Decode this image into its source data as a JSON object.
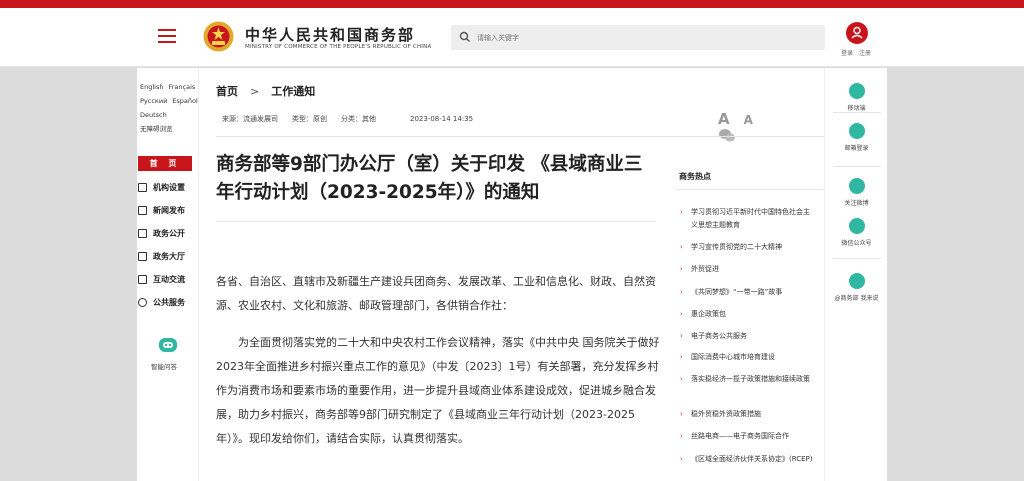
{
  "header": {
    "site_title": "中华人民共和国商务部",
    "site_subtitle": "MINISTRY OF COMMERCE OF THE PEOPLE'S REPUBLIC OF CHINA",
    "search_placeholder": "请输入关键字",
    "login": "登录",
    "register": "注册"
  },
  "left": {
    "langs": [
      "English",
      "Français",
      "Русский",
      "Español",
      "Deutsch",
      "无障碍浏览"
    ],
    "home": "首 页",
    "nav": [
      "机构设置",
      "新闻发布",
      "政务公开",
      "政务大厅",
      "互动交流",
      "公共服务"
    ],
    "assistant": "智能问答"
  },
  "article": {
    "breadcrumb_home": "首页",
    "breadcrumb_sep": ">",
    "breadcrumb_current": "工作通知",
    "source": "来源：流通发展司",
    "type": "类型：原创",
    "category": "分类：其他",
    "date": "2023-08-14 14:35",
    "title": "商务部等9部门办公厅（室）关于印发 《县域商业三年行动计划（2023-2025年）》的通知",
    "para1": "各省、自治区、直辖市及新疆生产建设兵团商务、发展改革、工业和信息化、财政、自然资源、农业农村、文化和旅游、邮政管理部门，各供销合作社：",
    "para2": "为全面贯彻落实党的二十大和中央农村工作会议精神，落实《中共中央 国务院关于做好2023年全面推进乡村振兴重点工作的意见》（中发〔2023〕1号）有关部署，充分发挥乡村作为消费市场和要素市场的重要作用，进一步提升县域商业体系建设成效，促进城乡融合发展，助力乡村振兴，商务部等9部门研究制定了《县域商业三年行动计划（2023-2025年）》。现印发给你们，请结合实际，认真贯彻落实。"
  },
  "tools": {
    "font_large": "A",
    "font_small": "A"
  },
  "hot": {
    "title": "商务热点",
    "items": [
      "学习贯彻习近平新时代中国特色社会主义思想主题教育",
      "学习宣传贯彻党的二十大精神",
      "外贸促进",
      "《共同梦想》“一带一路”故事",
      "惠企政策包",
      "电子商务公共服务",
      "国际消费中心城市培育建设",
      "落实稳经济一揽子政策措施和接续政策",
      "稳外贸稳外资政策措施",
      "丝路电商——电子商务国际合作",
      "《区域全面经济伙伴关系协定》(RCEP)"
    ]
  },
  "right": {
    "items": [
      "移动端",
      "邮箱登录",
      "关注微博",
      "微信公众号",
      "@商务部 我来说"
    ]
  },
  "colors": {
    "brand_red": "#c8151b",
    "teal": "#2fb7a2"
  }
}
